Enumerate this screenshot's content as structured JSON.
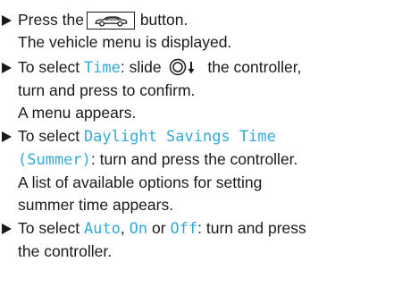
{
  "steps": [
    {
      "lines": [
        {
          "before": "Press the",
          "after": "button."
        },
        {
          "text": "The vehicle menu is displayed."
        }
      ],
      "icon": "vehicle-button-icon"
    },
    {
      "lines": [
        {
          "before": "To select",
          "term": "Time",
          "mid": ": slide",
          "after": "the controller,"
        },
        {
          "text": "turn and press to confirm."
        },
        {
          "text": "A menu appears."
        }
      ],
      "icon": "controller-slide-down-icon"
    },
    {
      "lines": [
        {
          "before": "To select",
          "term": "Daylight Savings Time"
        },
        {
          "term": "(Summer)",
          "after": ": turn and press the controller."
        },
        {
          "text": "A list of available options for setting"
        },
        {
          "text": "summer time appears."
        }
      ]
    },
    {
      "lines": [
        {
          "before": "To select",
          "term1": "Auto",
          "sep1": ",",
          "term2": "On",
          "sep2": "or",
          "term3": "Off",
          "after": ": turn and press"
        },
        {
          "text": "the controller."
        }
      ]
    }
  ],
  "colors": {
    "text": "#1a1a1a",
    "display_term": "#33a9d6"
  }
}
